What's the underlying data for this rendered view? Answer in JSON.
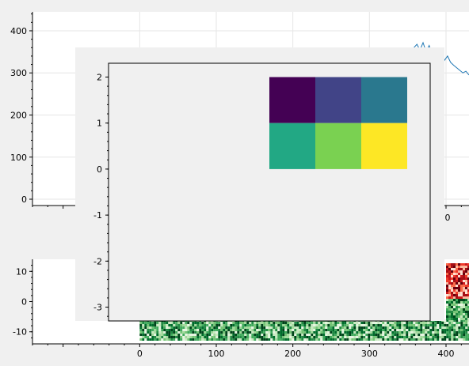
{
  "chart_data": [
    {
      "type": "line",
      "x": [
        0,
        100,
        200,
        300,
        400
      ],
      "xlim": [
        -140,
        430
      ],
      "y_ticks": [
        0,
        100,
        200,
        300,
        400
      ],
      "ylim": [
        -15,
        445
      ],
      "x_tick_labels_visible": [
        "0"
      ],
      "series": [
        {
          "color": "#1f77b4",
          "x": [
            358,
            362,
            366,
            370,
            374,
            378,
            382,
            386,
            390,
            394,
            398,
            402,
            406,
            410,
            414,
            418,
            422,
            426,
            430
          ],
          "values": [
            360,
            368,
            354,
            372,
            350,
            365,
            345,
            358,
            340,
            352,
            330,
            340,
            325,
            318,
            312,
            306,
            300,
            304,
            295
          ]
        }
      ],
      "grid": true
    },
    {
      "type": "heatmap",
      "colormap": "Greens / Reds",
      "x_ticks": [
        0,
        100,
        200,
        300,
        400
      ],
      "xlim": [
        -140,
        430
      ],
      "y_ticks": [
        10,
        0,
        -10
      ],
      "ylim": [
        -14,
        14
      ]
    },
    {
      "type": "heatmap",
      "colormap": "viridis",
      "rows": [
        [
          0,
          1,
          2
        ],
        [
          3,
          4,
          5
        ]
      ],
      "colors": [
        "#440154",
        "#414487",
        "#2a788e",
        "#22a884",
        "#7ad151",
        "#fde725"
      ],
      "x_extent": [
        0,
        3
      ],
      "y_extent": [
        0,
        2
      ],
      "y_ticks": [
        2,
        1,
        0,
        -1,
        -2,
        -3
      ],
      "ylim": [
        -3.3,
        2.3
      ],
      "xlim": [
        -3.5,
        3.5
      ]
    }
  ],
  "labels": {
    "top_y": [
      "400",
      "300",
      "200",
      "100",
      "0"
    ],
    "top_x_fragment": "0",
    "bottom_y": [
      "10",
      "0",
      "-10"
    ],
    "bottom_x": [
      "0",
      "100",
      "200",
      "300",
      "400"
    ],
    "inset_y": [
      "2",
      "1",
      "0",
      "-1",
      "-2",
      "-3"
    ]
  }
}
